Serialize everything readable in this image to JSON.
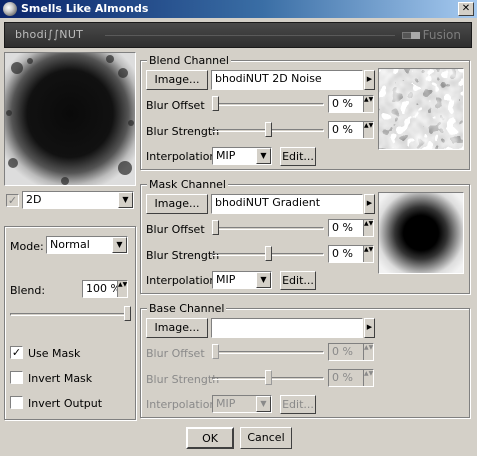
{
  "window": {
    "title": "Smells Like Almonds",
    "close_glyph": "✕"
  },
  "banner": {
    "logo": "bhodi∫∫NUT",
    "product": "Fusion"
  },
  "left": {
    "dimension": "2D",
    "mode_label": "Mode:",
    "mode_value": "Normal",
    "blend_label": "Blend:",
    "blend_value": "100 %",
    "blend_level": 1.0,
    "use_mask": {
      "label": "Use Mask",
      "checked": true
    },
    "invert_mask": {
      "label": "Invert Mask",
      "checked": false
    },
    "invert_output": {
      "label": "Invert Output",
      "checked": false
    }
  },
  "blend_channel": {
    "title": "Blend Channel",
    "image_button": "Image...",
    "shader": "bhodiNUT 2D Noise",
    "blur_offset_label": "Blur Offset",
    "blur_offset_value": "0 %",
    "blur_offset_level": 0.0,
    "blur_strength_label": "Blur Strength",
    "blur_strength_value": "0 %",
    "blur_strength_level": 0.5,
    "interpolation_label": "Interpolation",
    "interpolation_value": "MIP",
    "edit_button": "Edit..."
  },
  "mask_channel": {
    "title": "Mask Channel",
    "image_button": "Image...",
    "shader": "bhodiNUT Gradient",
    "blur_offset_label": "Blur Offset",
    "blur_offset_value": "0 %",
    "blur_offset_level": 0.0,
    "blur_strength_label": "Blur Strength",
    "blur_strength_value": "0 %",
    "blur_strength_level": 0.5,
    "interpolation_label": "Interpolation",
    "interpolation_value": "MIP",
    "edit_button": "Edit..."
  },
  "base_channel": {
    "title": "Base Channel",
    "image_button": "Image...",
    "shader": "",
    "blur_offset_label": "Blur Offset",
    "blur_offset_value": "0 %",
    "blur_offset_level": 0.0,
    "blur_strength_label": "Blur Strength",
    "blur_strength_value": "0 %",
    "blur_strength_level": 0.5,
    "interpolation_label": "Interpolation",
    "interpolation_value": "MIP",
    "edit_button": "Edit..."
  },
  "footer": {
    "ok": "OK",
    "cancel": "Cancel"
  },
  "glyphs": {
    "arrow_right": "▶",
    "arrow_down": "▼",
    "spin": "▲▼",
    "check": "✓"
  }
}
